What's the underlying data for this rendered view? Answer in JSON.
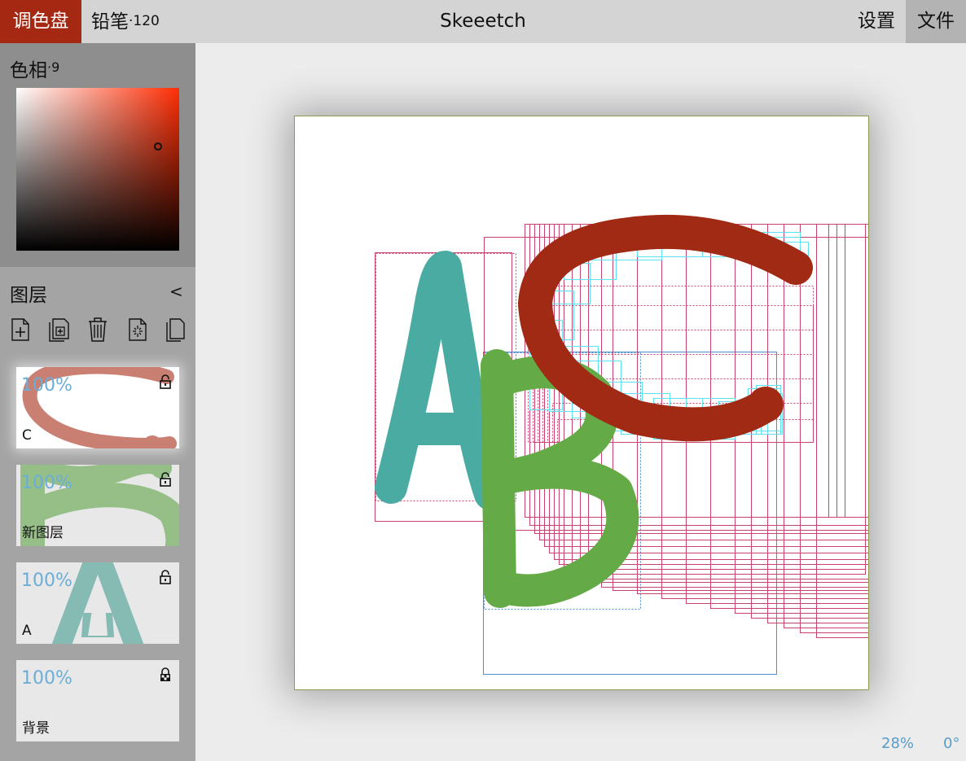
{
  "app_title": "Skeeetch",
  "toolbar": {
    "palette_label": "调色盘",
    "brush_label": "铅笔",
    "brush_size": "·120",
    "settings_label": "设置",
    "file_label": "文件"
  },
  "colors": {
    "accent": "#a52812",
    "selected_color": "#a02a14",
    "hue_color": "#ff2e05",
    "stroke_c": "#a02a14",
    "stroke_b": "#64ab48",
    "stroke_a": "#4aaba3",
    "bbox_pink": "#c8436e",
    "bbox_cyan": "#5fe2ef",
    "bbox_blue": "#4a8fd0",
    "status_text": "#5b9dc9"
  },
  "color_picker": {
    "hue_label": "色相",
    "hue_value": "·9"
  },
  "layers_panel": {
    "title": "图层",
    "collapse_icon": "<",
    "tools": [
      "new-layer-icon",
      "new-group-icon",
      "delete-icon",
      "clear-icon",
      "duplicate-icon"
    ],
    "layers": [
      {
        "name": "C",
        "opacity": "100%",
        "locked": false,
        "active": true
      },
      {
        "name": "新图层",
        "opacity": "100%",
        "locked": false,
        "active": false
      },
      {
        "name": "A",
        "opacity": "100%",
        "locked": false,
        "active": false
      },
      {
        "name": "背景",
        "opacity": "100%",
        "locked": true,
        "active": false
      }
    ]
  },
  "status": {
    "zoom": "28%",
    "rotation": "0°"
  }
}
